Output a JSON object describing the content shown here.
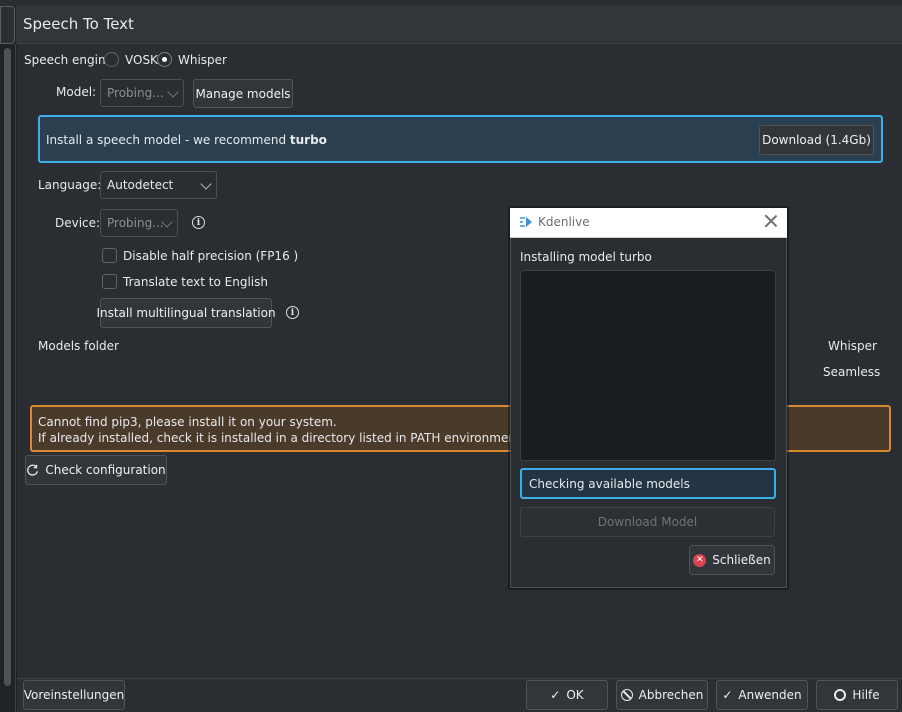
{
  "window": {
    "title": "Speech To Text"
  },
  "engine": {
    "label": "Speech engine",
    "options": [
      "VOSK",
      "Whisper"
    ],
    "selected": "Whisper"
  },
  "model": {
    "label": "Model:",
    "value": "Probing...",
    "manage_button": "Manage models"
  },
  "install_banner": {
    "text_prefix": "Install a speech model - we recommend ",
    "text_bold": "turbo",
    "download_button": "Download (1.4Gb)"
  },
  "language": {
    "label": "Language:",
    "value": "Autodetect"
  },
  "device": {
    "label": "Device:",
    "value": "Probing..."
  },
  "options": {
    "fp16": "Disable half precision (FP16 )",
    "translate": "Translate text to English",
    "multilingual_button": "Install multilingual translation"
  },
  "models_folder": {
    "label": "Models folder",
    "whisper": "Whisper",
    "seamless": "Seamless"
  },
  "error_banner": {
    "line1": "Cannot find pip3, please install it on your system.",
    "line2": "If already installed, check it is installed in a directory listed in PATH environment variable"
  },
  "check_config_button": "Check configuration",
  "bottom": {
    "defaults": "Voreinstellungen",
    "ok": "OK",
    "cancel": "Abbrechen",
    "apply": "Anwenden",
    "help": "Hilfe"
  },
  "dialog": {
    "title": "Kdenlive",
    "heading": "Installing model turbo",
    "status": "Checking available models",
    "download_button": "Download Model",
    "close_button": "Schließen"
  },
  "colors": {
    "accent": "#3daee9",
    "warning": "#d78a2e",
    "close_red": "#da4453"
  }
}
